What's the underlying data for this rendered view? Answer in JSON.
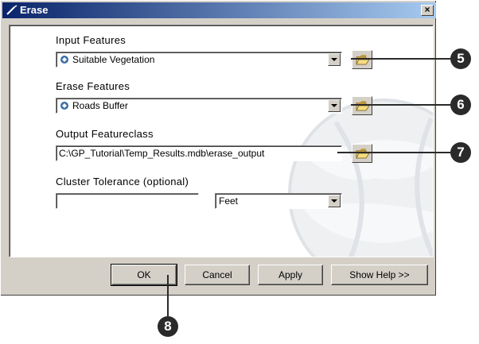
{
  "window": {
    "title": "Erase",
    "close_glyph": "×"
  },
  "fields": {
    "input_features": {
      "label": "Input Features",
      "value": "Suitable Vegetation",
      "icon": "layer-icon"
    },
    "erase_features": {
      "label": "Erase Features",
      "value": "Roads Buffer",
      "icon": "layer-icon"
    },
    "output_featureclass": {
      "label": "Output Featureclass",
      "value": "C:\\GP_Tutorial\\Temp_Results.mdb\\erase_output"
    },
    "cluster_tolerance": {
      "label": "Cluster Tolerance (optional)",
      "value": "",
      "units": "Feet"
    }
  },
  "buttons": {
    "ok": "OK",
    "cancel": "Cancel",
    "apply": "Apply",
    "show_help": "Show Help >>"
  },
  "callouts": {
    "c5": "5",
    "c6": "6",
    "c7": "7",
    "c8": "8"
  },
  "colors": {
    "titlebar": "#0a246a",
    "dialog_bg": "#d4d0c8",
    "callout": "#2a2a2a"
  }
}
